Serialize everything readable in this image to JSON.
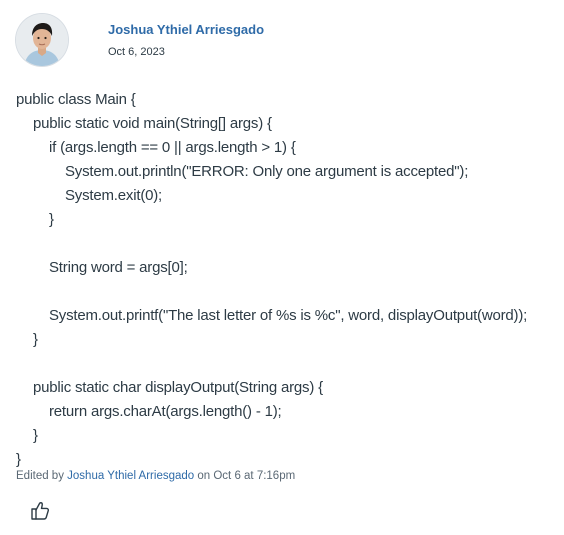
{
  "post": {
    "author": "Joshua Ythiel Arriesgado",
    "date": "Oct 6, 2023"
  },
  "code_lines": [
    "public class Main {",
    "public static void main(String[] args) {",
    "if (args.length == 0 || args.length > 1) {",
    "System.out.println(\"ERROR: Only one argument is accepted\");",
    "System.exit(0);",
    "}",
    "",
    "String word = args[0];",
    "",
    "System.out.printf(\"The last letter of %s is %c\", word, displayOutput(word));",
    "}",
    "",
    "public static char displayOutput(String args) {",
    "return args.charAt(args.length() - 1);",
    "}",
    "}"
  ],
  "edited": {
    "prefix": "Edited by",
    "editor": "Joshua Ythiel Arriesgado",
    "on_text": "on Oct 6 at 7:16pm"
  },
  "icons": {
    "avatar": "user-avatar",
    "like": "thumbs-up-icon"
  }
}
